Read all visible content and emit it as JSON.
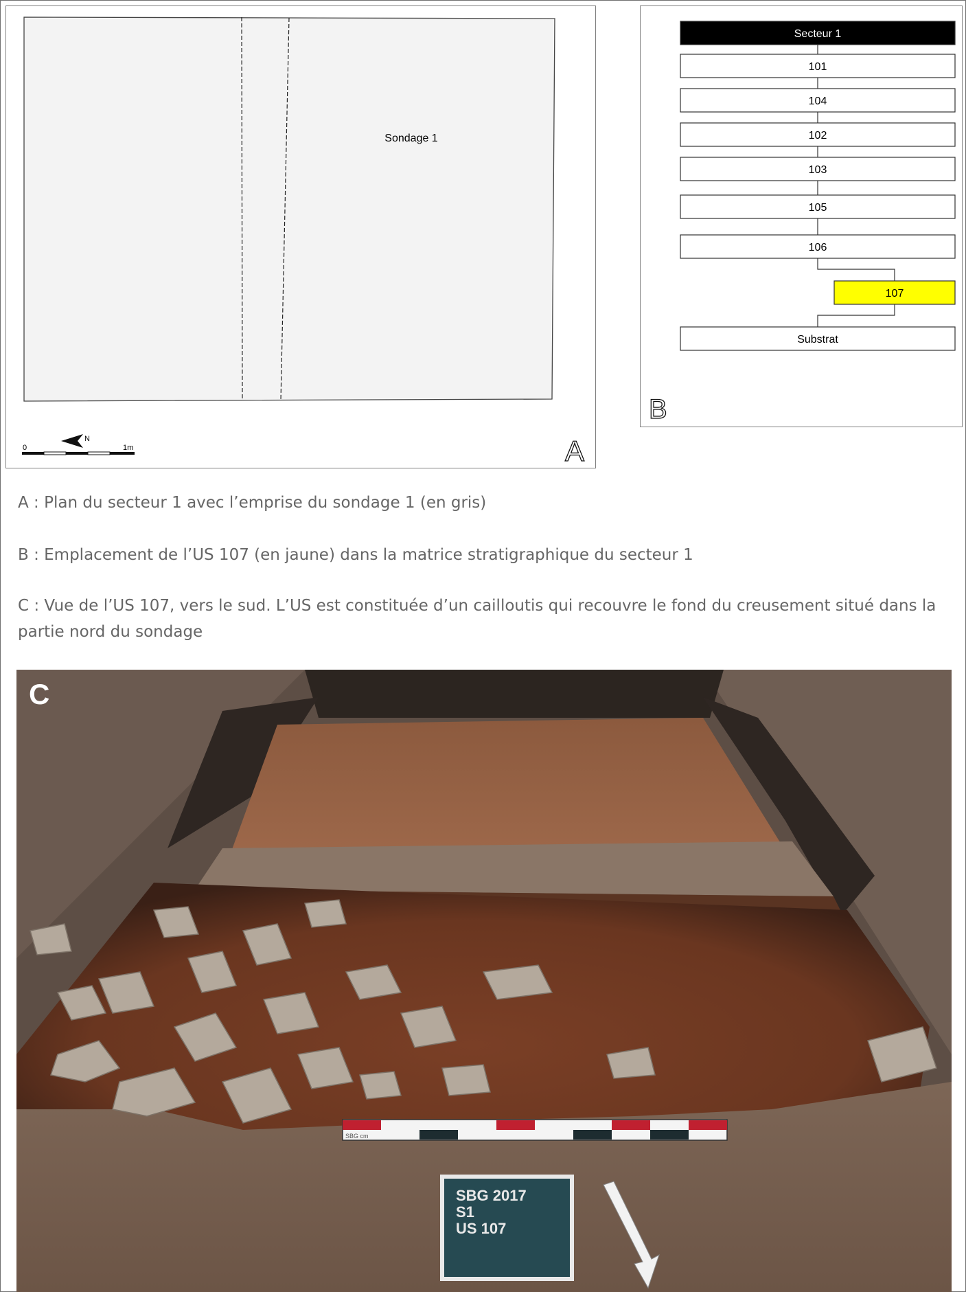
{
  "panel_a": {
    "letter": "A",
    "sondage_label": "Sondage 1",
    "scale": {
      "start": "0",
      "end": "1m",
      "north": "N"
    }
  },
  "panel_b": {
    "letter": "B",
    "nodes": [
      {
        "label": "Secteur 1",
        "style": "header"
      },
      {
        "label": "101",
        "style": "normal"
      },
      {
        "label": "104",
        "style": "normal"
      },
      {
        "label": "102",
        "style": "normal"
      },
      {
        "label": "103",
        "style": "normal"
      },
      {
        "label": "105",
        "style": "normal"
      },
      {
        "label": "106",
        "style": "normal"
      },
      {
        "label": "107",
        "style": "highlight"
      },
      {
        "label": "Substrat",
        "style": "normal"
      }
    ],
    "colors": {
      "header": "#000000",
      "highlight": "#ffff00"
    }
  },
  "captions": {
    "a": "A : Plan du secteur 1 avec l’emprise du sondage 1 (en gris)",
    "b": "B : Emplacement de l’US 107 (en jaune) dans la matrice stratigraphique du secteur 1",
    "c": "C : Vue de l’US 107, vers le sud. L’US est constituée d’un cailloutis qui recouvre le fond du creusement situé dans la partie nord du sondage"
  },
  "photo": {
    "letter": "C",
    "board_lines": [
      "SBG 2017",
      "S1",
      "US 107"
    ],
    "ruler_label": "SBG cm"
  }
}
